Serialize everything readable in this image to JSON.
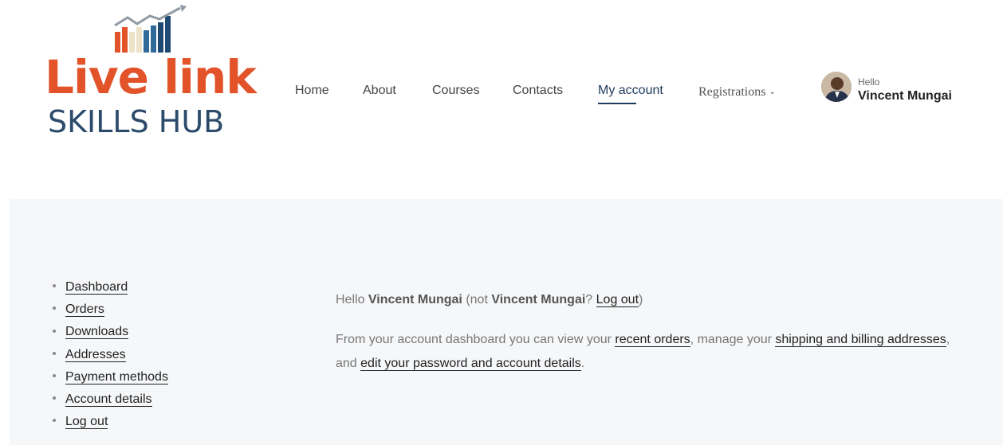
{
  "logo": {
    "line1": "Live link",
    "line2": "SKILLS HUB",
    "colors": {
      "orange": "#e2532a",
      "navy": "#2c4b6b",
      "beige": "#ede3c9",
      "blue": "#2f6a9a"
    }
  },
  "nav": {
    "items": [
      {
        "label": "Home"
      },
      {
        "label": "About"
      },
      {
        "label": "Courses"
      },
      {
        "label": "Contacts"
      },
      {
        "label": "My account"
      },
      {
        "label": "Registrations"
      }
    ],
    "active": "My account"
  },
  "user": {
    "greeting": "Hello",
    "name": "Vincent Mungai"
  },
  "sidebar": {
    "items": [
      {
        "label": "Dashboard"
      },
      {
        "label": "Orders"
      },
      {
        "label": "Downloads"
      },
      {
        "label": "Addresses"
      },
      {
        "label": "Payment methods"
      },
      {
        "label": "Account details"
      },
      {
        "label": "Log out"
      }
    ]
  },
  "main": {
    "hello": "Hello",
    "name": "Vincent Mungai",
    "not": "(not",
    "name2": "Vincent Mungai",
    "q": "?",
    "logout": "Log out",
    "close": ")",
    "p2_a": "From your account dashboard you can view your",
    "recent_orders": "recent orders",
    "p2_b": ", manage your",
    "addresses_link": "shipping and billing addresses",
    "p2_c": ",",
    "p2_d": "and",
    "edit_link": "edit your password and account details",
    "p2_e": "."
  }
}
